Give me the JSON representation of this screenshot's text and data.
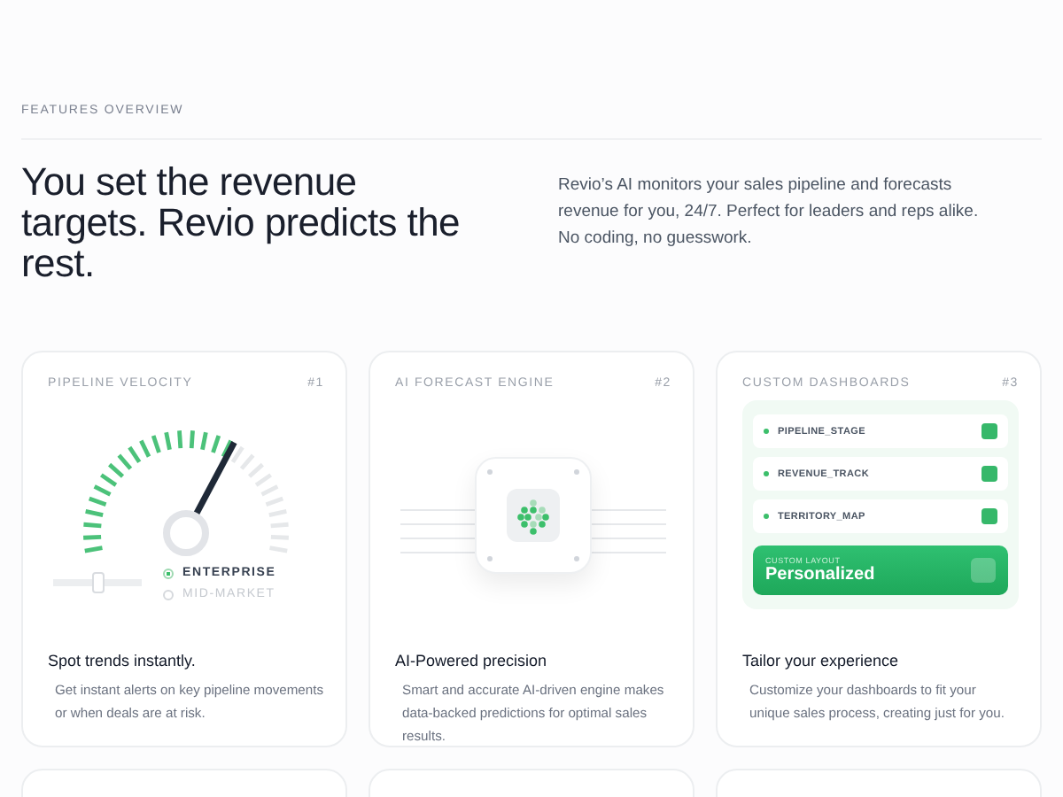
{
  "section_label": "FEATURES OVERVIEW",
  "headline": "You set the revenue targets. Revio predicts the rest.",
  "intro": "Revio’s AI monitors your sales pipeline and forecasts revenue for you, 24/7. Perfect for leaders and reps alike. No coding, no guesswork.",
  "cards": [
    {
      "kind": "gauge",
      "label": "PIPELINE VELOCITY",
      "number": "#1",
      "title": "Spot trends instantly.",
      "description": "Get instant alerts on key pipeline movements or when deals are at risk.",
      "gauge": {
        "level": 0.64
      },
      "slider": {
        "level": 0.5
      },
      "options": [
        {
          "label": "ENTERPRISE",
          "selected": true
        },
        {
          "label": "MID-MARKET",
          "selected": false
        }
      ]
    },
    {
      "kind": "chip",
      "label": "AI FORECAST ENGINE",
      "number": "#2",
      "title": "AI-Powered precision",
      "description": "Smart and accurate AI-driven engine makes data-backed predictions for optimal sales results."
    },
    {
      "kind": "dashboard",
      "label": "CUSTOM DASHBOARDS",
      "number": "#3",
      "title": "Tailor your experience",
      "description": "Customize your dashboards to fit your unique sales process, creating just for you.",
      "rows": [
        "PIPELINE_STAGE",
        "REVENUE_TRACK",
        "TERRITORY_MAP"
      ],
      "banner": {
        "caption": "CUSTOM LAYOUT",
        "title": "Personalized"
      }
    }
  ]
}
